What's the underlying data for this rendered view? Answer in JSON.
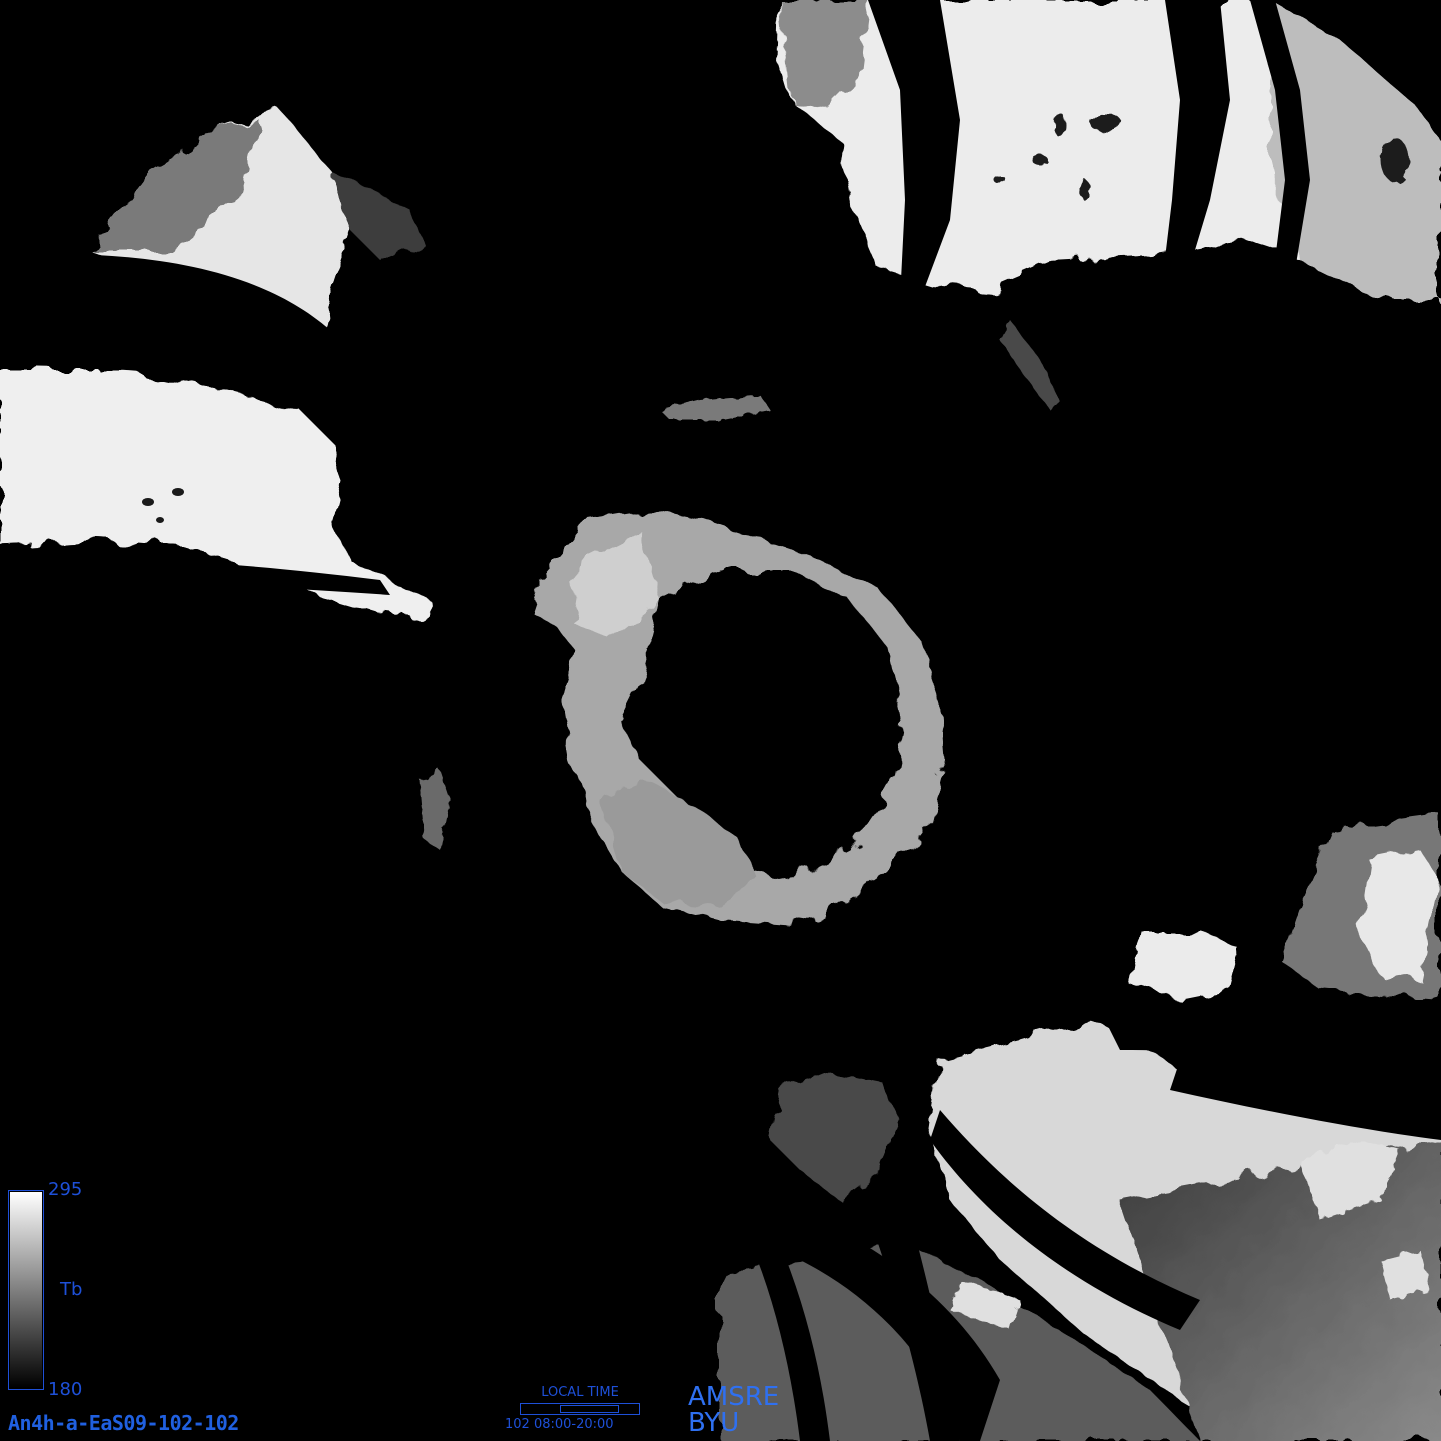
{
  "colorbar": {
    "max_label": "295",
    "min_label": "180",
    "variable_label": "Tb",
    "ramp_colors": [
      "#000000",
      "#ffffff"
    ],
    "border_color": "#1e50d8"
  },
  "image_id": "An4h-a-EaS09-102-102",
  "local_time": {
    "title": "LOCAL TIME",
    "caption": "102  08:00-20:00",
    "day_of_year": 102,
    "window_start_hour": 8,
    "window_end_hour": 20
  },
  "credits": {
    "line1": "AMSRE",
    "line2": "BYU"
  },
  "annotation_color": "#1e50d8"
}
